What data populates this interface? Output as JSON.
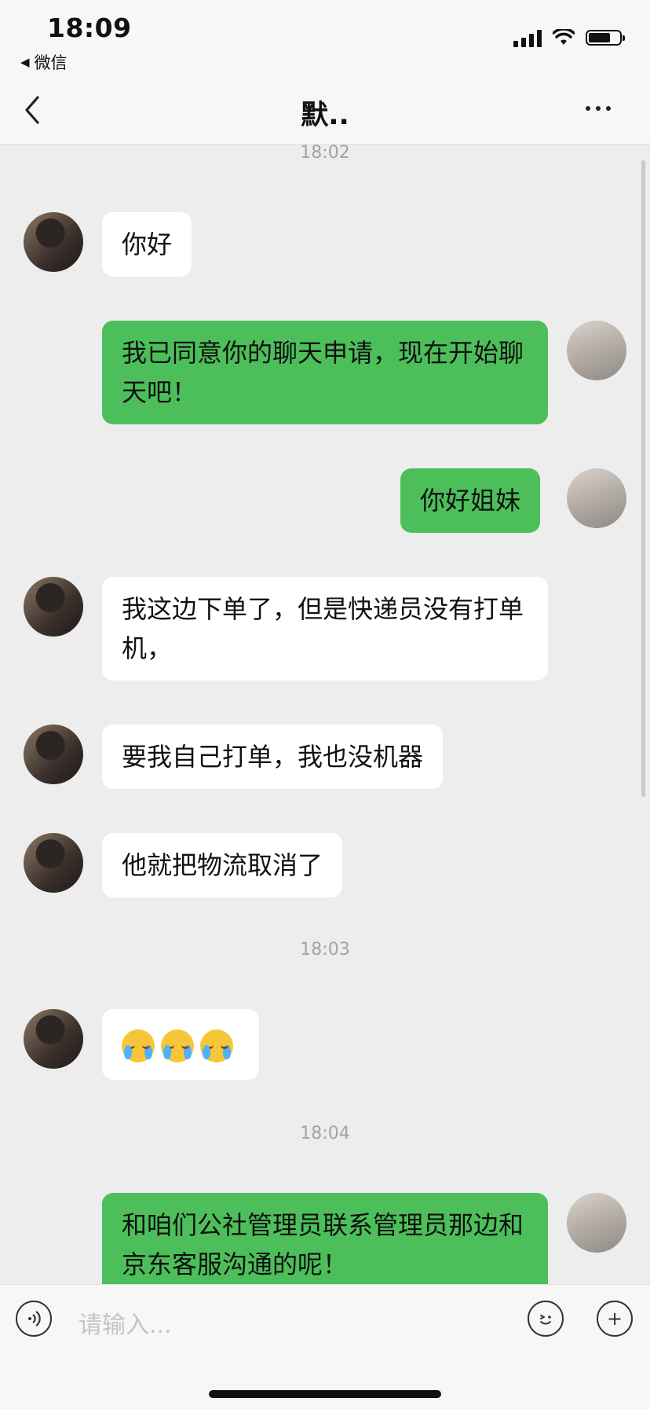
{
  "status_bar": {
    "time": "18:09",
    "back_app_label": "微信",
    "back_app_arrow": "◀"
  },
  "nav": {
    "title": "默..",
    "back_icon": "chevron-left-icon",
    "more_icon": "more-dots-icon"
  },
  "timestamps": [
    "18:02",
    "18:03",
    "18:04"
  ],
  "messages": [
    {
      "side": "left",
      "text": "你好"
    },
    {
      "side": "right",
      "text": "我已同意你的聊天申请，现在开始聊天吧！"
    },
    {
      "side": "right",
      "text": "你好姐妹"
    },
    {
      "side": "left",
      "text": "我这边下单了，但是快递员没有打单机，"
    },
    {
      "side": "left",
      "text": "要我自己打单，我也没机器"
    },
    {
      "side": "left",
      "text": "他就把物流取消了"
    },
    {
      "side": "left",
      "text": "",
      "emoji": [
        "loudly-crying-face",
        "loudly-crying-face",
        "loudly-crying-face"
      ]
    },
    {
      "side": "right",
      "text": "和咱们公社管理员联系管理员那边和京东客服沟通的呢！"
    }
  ],
  "input_bar": {
    "placeholder": "请输入...",
    "voice_icon": "voice-icon",
    "emoji_icon": "emoji-icon",
    "plus_icon": "plus-icon",
    "plus_glyph": "+"
  },
  "colors": {
    "sent_bubble": "#4cbf5a",
    "received_bubble": "#ffffff",
    "background": "#ededed"
  }
}
